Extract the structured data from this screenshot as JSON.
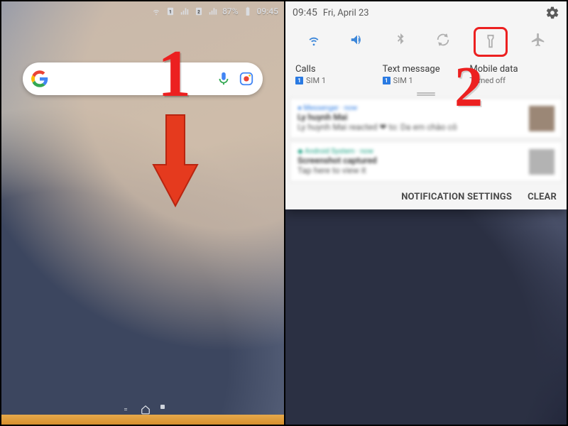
{
  "left": {
    "status": {
      "battery": "87%",
      "time": "09:45"
    },
    "annotation": "1"
  },
  "right": {
    "shade_time": "09:45",
    "shade_date": "Fri, April 23",
    "sim": {
      "calls": {
        "label": "Calls",
        "sim": "SIM 1"
      },
      "text": {
        "label": "Text message",
        "sim": "SIM 1"
      },
      "data": {
        "label": "Mobile data",
        "sub": "Turned off"
      }
    },
    "footer": {
      "settings": "NOTIFICATION SETTINGS",
      "clear": "CLEAR"
    },
    "annotation": "2"
  }
}
